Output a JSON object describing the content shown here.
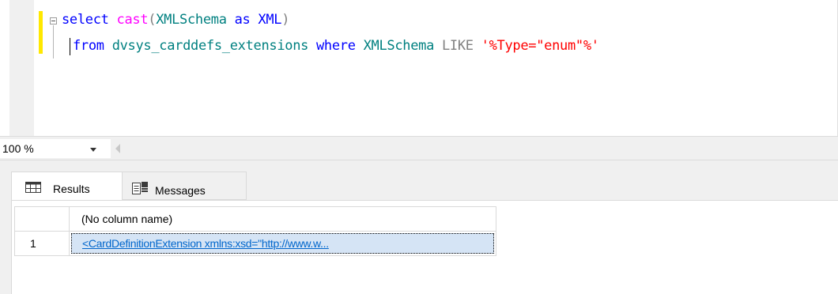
{
  "editor": {
    "line1": {
      "select": "select",
      "cast": "cast",
      "lparen": "(",
      "col": "XMLSchema",
      "as": "as",
      "type": "XML",
      "rparen": ")"
    },
    "line2": {
      "from": "from",
      "table": "dvsys_carddefs_extensions",
      "where": "where",
      "col": "XMLSchema",
      "like": "LIKE",
      "pattern": "'%Type=\"enum\"%'"
    }
  },
  "zoom": {
    "value": "100 %"
  },
  "tabs": {
    "results": "Results",
    "messages": "Messages"
  },
  "grid": {
    "column_header": "(No column name)",
    "rows": [
      {
        "num": "1",
        "value": "<CardDefinitionExtension xmlns:xsd=\"http://www.w..."
      }
    ]
  },
  "colors": {
    "keyword": "#0000ff",
    "function": "#ff00ff",
    "string": "#ff0000",
    "identifier": "#008080",
    "link": "#0066cc"
  }
}
